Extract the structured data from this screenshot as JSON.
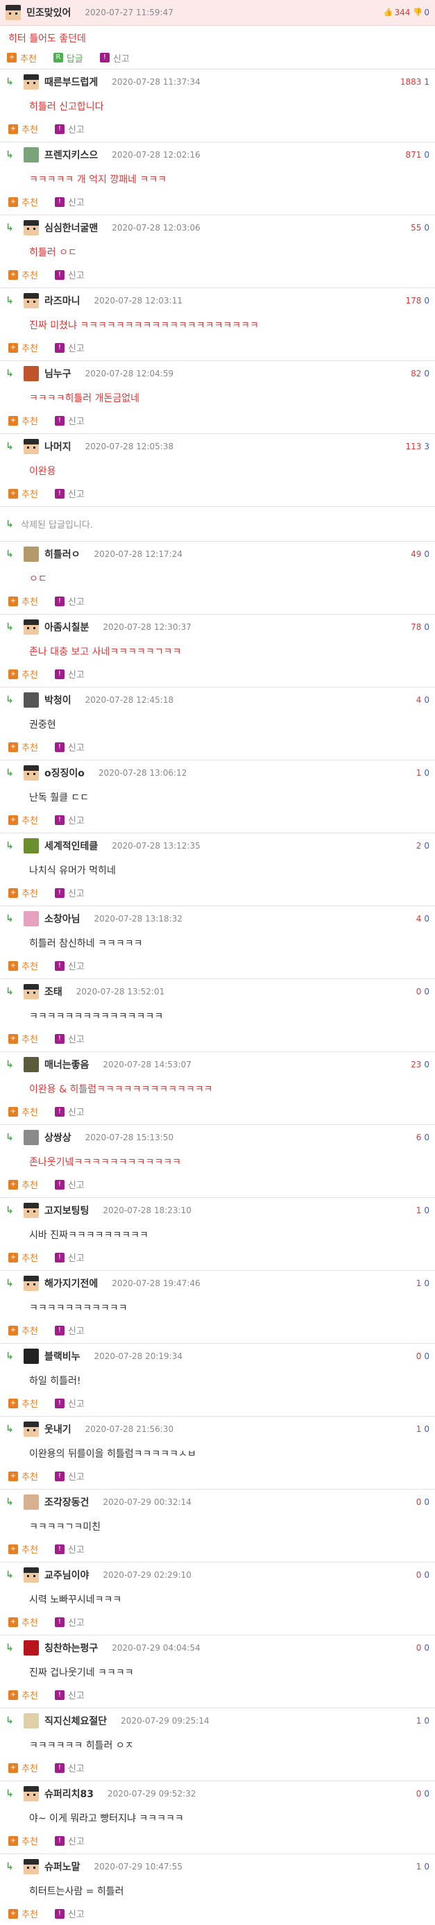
{
  "labels": {
    "recommend": "추천",
    "answer": "답글",
    "report": "신고"
  },
  "main_comment": {
    "nickname": "민조맞있어",
    "date": "2020-07-27 11:59:47",
    "up": "344",
    "down": "0",
    "text": "히터 틀어도 좋던데"
  },
  "deleted_text": "삭제된 답글입니다.",
  "replies": [
    {
      "nickname": "때른부드럽게",
      "date": "2020-07-28 11:37:34",
      "up": "1883",
      "down": "1",
      "text": "히틀러 신고합니다",
      "color": "red",
      "avatar": "default"
    },
    {
      "nickname": "프렌지키스으",
      "date": "2020-07-28 12:02:16",
      "up": "871",
      "down": "0",
      "text": "ㅋㅋㅋㅋㅋ 개 억지 깡패네 ㅋㅋㅋ",
      "color": "red",
      "avatar": "frog"
    },
    {
      "nickname": "심심한너굴맨",
      "date": "2020-07-28 12:03:06",
      "up": "55",
      "down": "0",
      "text": "히틀러 ㅇㄷ",
      "color": "red",
      "avatar": "default"
    },
    {
      "nickname": "라즈마니",
      "date": "2020-07-28 12:03:11",
      "up": "178",
      "down": "0",
      "text": "진짜 미쳤냐 ㅋㅋㅋㅋㅋㅋㅋㅋㅋㅋㅋㅋㅋㅋㅋㅋㅋㅋㅋㅋ",
      "color": "red",
      "avatar": "default"
    },
    {
      "nickname": "님누구",
      "date": "2020-07-28 12:04:59",
      "up": "82",
      "down": "0",
      "text": "ㅋㅋㅋㅋ히틀러 개돈금없네",
      "color": "red",
      "avatar": "anime"
    },
    {
      "nickname": "나머지",
      "date": "2020-07-28 12:05:38",
      "up": "113",
      "down": "3",
      "text": "이완용",
      "color": "red",
      "avatar": "default"
    },
    {
      "deleted": true
    },
    {
      "nickname": "히틀러ㅇ",
      "date": "2020-07-28 12:17:24",
      "up": "49",
      "down": "0",
      "text": "ㅇㄷ",
      "color": "red",
      "avatar": "photo"
    },
    {
      "nickname": "아좀시칠분",
      "date": "2020-07-28 12:30:37",
      "up": "78",
      "down": "0",
      "text": "존나 대충 보고 사네ㅋㅋㅋㅋㅋㄱㅋㅋ",
      "color": "red",
      "avatar": "default"
    },
    {
      "nickname": "박청이",
      "date": "2020-07-28 12:45:18",
      "up": "4",
      "down": "0",
      "text": "권중현",
      "color": "dark",
      "avatar": "face"
    },
    {
      "nickname": "o징징이o",
      "date": "2020-07-28 13:06:12",
      "up": "1",
      "down": "0",
      "text": "난독 훨클 ㄷㄷ",
      "color": "dark",
      "avatar": "default"
    },
    {
      "nickname": "세계적인테클",
      "date": "2020-07-28 13:12:35",
      "up": "2",
      "down": "0",
      "text": "나치식 유머가 먹히네",
      "color": "dark",
      "avatar": "tree"
    },
    {
      "nickname": "소창아님",
      "date": "2020-07-28 13:18:32",
      "up": "4",
      "down": "0",
      "text": "히틀러 참신하네 ㅋㅋㅋㅋㅋ",
      "color": "dark",
      "avatar": "pink"
    },
    {
      "nickname": "조태",
      "date": "2020-07-28 13:52:01",
      "up": "0",
      "down": "0",
      "text": "ㅋㅋㅋㅋㅋㅋㅋㅋㅋㅋㅋㅋㅋㅋㅋ",
      "color": "dark",
      "avatar": "default"
    },
    {
      "nickname": "매너는좋음",
      "date": "2020-07-28 14:53:07",
      "up": "23",
      "down": "0",
      "text": "이완용 & 히틀럼ㅋㅋㅋㅋㅋㅋㅋㅋㅋㅋㅋㅋㅋ",
      "color": "red",
      "avatar": "olive"
    },
    {
      "nickname": "상쌍상",
      "date": "2020-07-28 15:13:50",
      "up": "6",
      "down": "0",
      "text": "존나웃기넼ㅋㅋㅋㅋㅋㅋㅋㅋㅋㅋㅋㅋ",
      "color": "red",
      "avatar": "gray"
    },
    {
      "nickname": "고지보팅팅",
      "date": "2020-07-28 18:23:10",
      "up": "1",
      "down": "0",
      "text": "시바 진짜ㅋㅋㅋㅋㅋㅋㅋㅋㅋ",
      "color": "dark",
      "avatar": "default"
    },
    {
      "nickname": "해가지기전에",
      "date": "2020-07-28 19:47:46",
      "up": "1",
      "down": "0",
      "text": "ㅋㅋㅋㅋㅋㅋㅋㅋㅋㅋㅋ",
      "color": "dark",
      "avatar": "default"
    },
    {
      "nickname": "블랙비누",
      "date": "2020-07-28 20:19:34",
      "up": "0",
      "down": "0",
      "text": "하일 히틀러!",
      "color": "dark",
      "avatar": "black"
    },
    {
      "nickname": "웃내기",
      "date": "2020-07-28 21:56:30",
      "up": "1",
      "down": "0",
      "text": "이완용의 뒤를이을 히틀럼ㅋㅋㅋㅋㅋㅅㅂ",
      "color": "dark",
      "avatar": "default"
    },
    {
      "nickname": "조각장동건",
      "date": "2020-07-29 00:32:14",
      "up": "0",
      "down": "0",
      "text": "ㅋㅋㅋㅋㄱㅋ미친",
      "color": "dark",
      "avatar": "face2"
    },
    {
      "nickname": "교주님이야",
      "date": "2020-07-29 02:29:10",
      "up": "0",
      "down": "0",
      "text": "시력 노빠꾸시네ㅋㅋㅋ",
      "color": "dark",
      "avatar": "default"
    },
    {
      "nickname": "칭찬하는펑구",
      "date": "2020-07-29 04:04:54",
      "up": "0",
      "down": "0",
      "text": "진짜 겁나웃기네 ㅋㅋㅋㅋ",
      "color": "dark",
      "avatar": "red"
    },
    {
      "nickname": "직지신체요절단",
      "date": "2020-07-29 09:25:14",
      "up": "1",
      "down": "0",
      "text": "ㅋㅋㅋㅋㅋㅋ 히틀러 ㅇㅈ",
      "color": "dark",
      "avatar": "beige"
    },
    {
      "nickname": "슈퍼리치83",
      "date": "2020-07-29 09:52:32",
      "up": "0",
      "down": "0",
      "text": "야~ 이게 뭐라고 빵터지냐 ㅋㅋㅋㅋㅋ",
      "color": "dark",
      "avatar": "default"
    },
    {
      "nickname": "슈퍼노말",
      "date": "2020-07-29 10:47:55",
      "up": "1",
      "down": "0",
      "text": "히터트는사람 = 히틀러",
      "color": "dark",
      "avatar": "default"
    }
  ],
  "colors": {
    "accent_red": "#e23838",
    "accent_blue": "#3b5bd9",
    "recommend_orange": "#e67e22",
    "answer_green": "#4caf50",
    "report_purple": "#a01d8a",
    "header_bg": "#fceaea"
  }
}
